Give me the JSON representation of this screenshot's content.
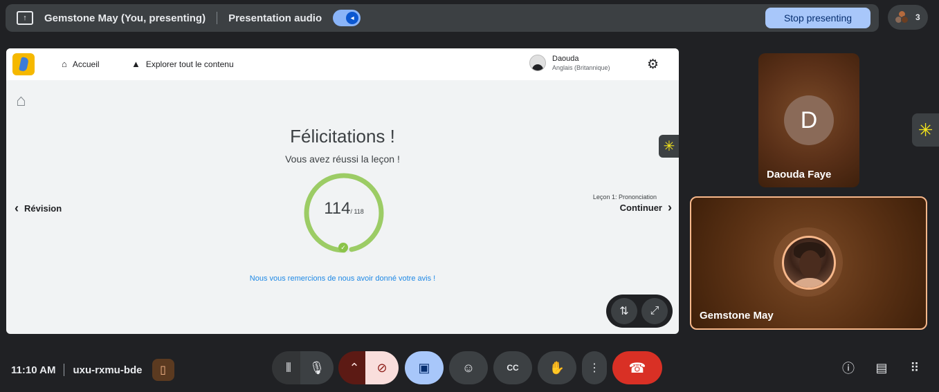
{
  "topbar": {
    "presenter": "Gemstone May (You, presenting)",
    "audio_label": "Presentation audio",
    "stop_label": "Stop presenting",
    "participant_count": "3"
  },
  "app": {
    "nav": [
      "Accueil",
      "Explorer tout le contenu"
    ],
    "user_name": "Daouda",
    "user_lang": "Anglais (Britannique)",
    "congrats": "Félicitations !",
    "subtitle": "Vous avez réussi la leçon !",
    "score": "114",
    "score_total": "/ 118",
    "back_label": "Révision",
    "lesson_label": "Leçon 1: Prononciation",
    "continue_label": "Continuer",
    "thanks": "Nous vous remercions de nous avoir donné votre avis !"
  },
  "tiles": {
    "daouda_initial": "D",
    "daouda_name": "Daouda Faye",
    "gemstone_name": "Gemstone May"
  },
  "bottombar": {
    "time": "11:10 AM",
    "meeting_code": "uxu-rxmu-bde"
  },
  "colors": {
    "accent_blue": "#a8c7fa",
    "ring_green": "#9ccc65",
    "end_call_red": "#d93025",
    "highlight_border": "#f8b88b"
  }
}
